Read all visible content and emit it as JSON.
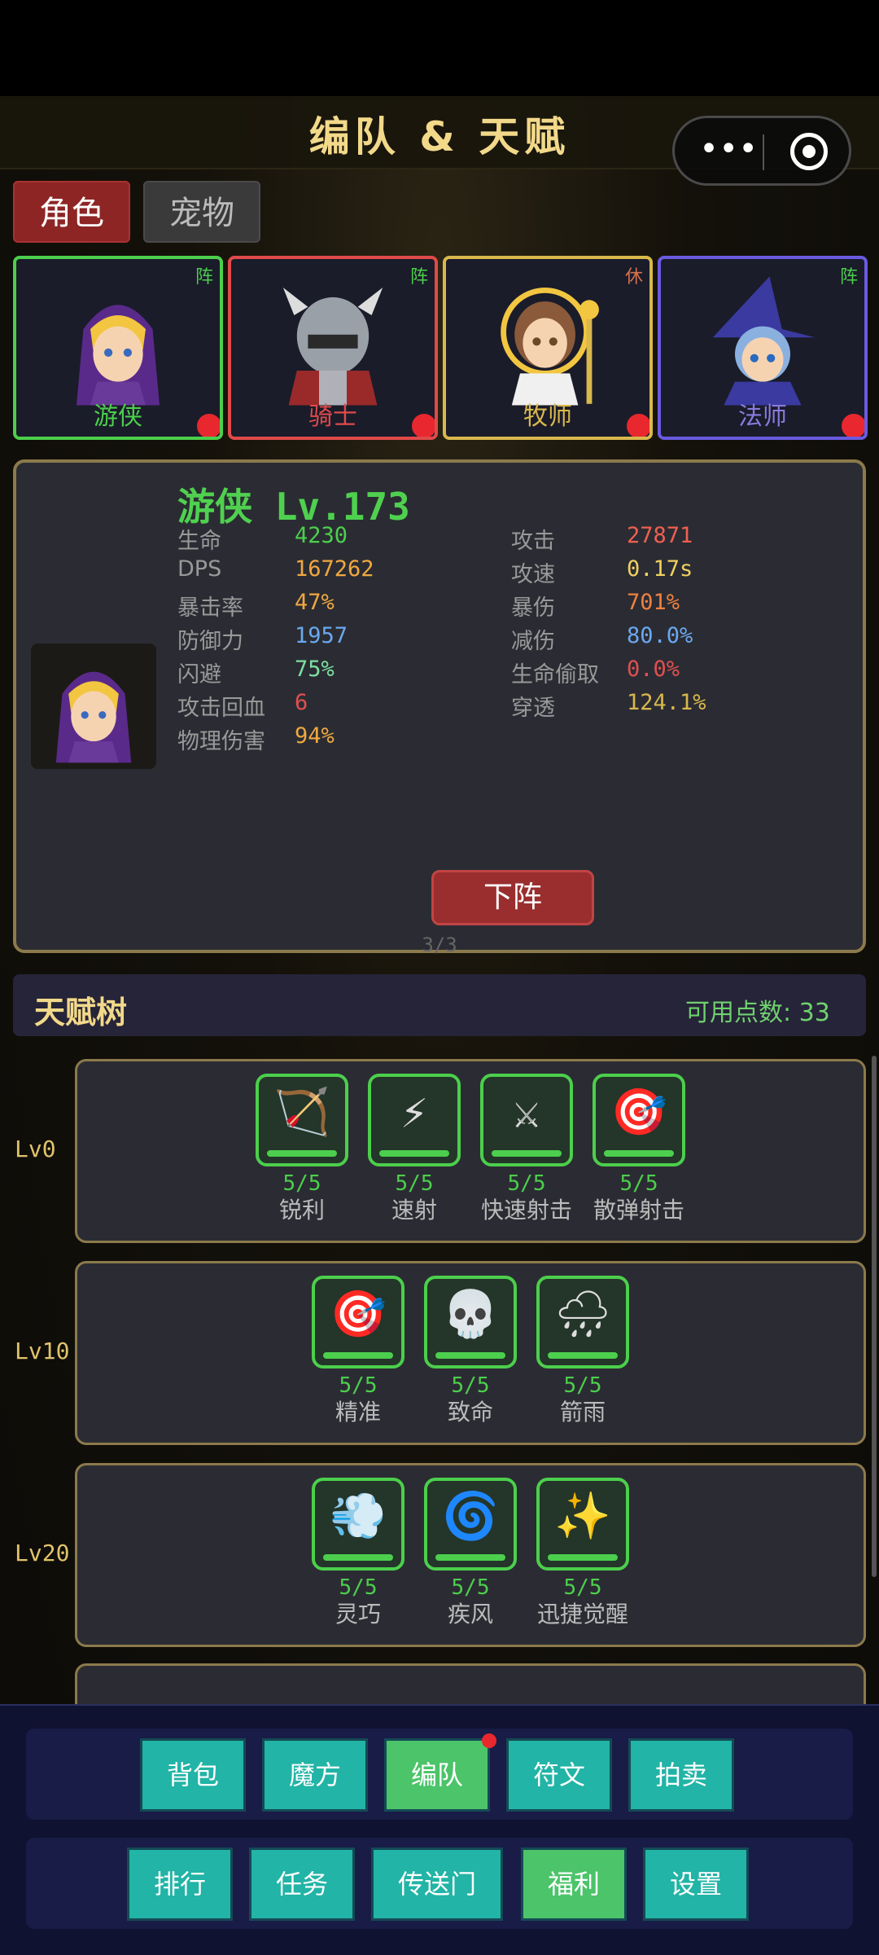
{
  "header": {
    "title": "编队 & 天赋"
  },
  "tabs": [
    {
      "label": "角色"
    },
    {
      "label": "宠物"
    }
  ],
  "heroes": [
    {
      "name": "游侠",
      "tag": "阵",
      "color": "#4ccf4c"
    },
    {
      "name": "骑士",
      "tag": "阵",
      "color": "#e04a4a"
    },
    {
      "name": "牧师",
      "tag": "休",
      "color": "#d9b84c"
    },
    {
      "name": "法师",
      "tag": "阵",
      "color": "#6a5ae0"
    }
  ],
  "selected": {
    "title": "游侠 Lv.173",
    "left_stats": [
      {
        "label": "生命",
        "value": "4230",
        "color": "#4ccf4c"
      },
      {
        "label": "DPS",
        "value": "167262",
        "color": "#f0a840"
      },
      {
        "label": "暴击率",
        "value": "47%",
        "color": "#f0a840"
      },
      {
        "label": "防御力",
        "value": "1957",
        "color": "#6aa8f0"
      },
      {
        "label": "闪避",
        "value": "75%",
        "color": "#7ee0a0"
      },
      {
        "label": "攻击回血",
        "value": "6",
        "color": "#e05050"
      },
      {
        "label": "物理伤害",
        "value": "94%",
        "color": "#f0a840"
      }
    ],
    "right_stats": [
      {
        "label": "攻击",
        "value": "27871",
        "color": "#f06050"
      },
      {
        "label": "攻速",
        "value": "0.17s",
        "color": "#f0d060"
      },
      {
        "label": "暴伤",
        "value": "701%",
        "color": "#f08040"
      },
      {
        "label": "减伤",
        "value": "80.0%",
        "color": "#6aa8f0"
      },
      {
        "label": "生命偷取",
        "value": "0.0%",
        "color": "#e05050"
      },
      {
        "label": "穿透",
        "value": "124.1%",
        "color": "#d9b84c"
      }
    ],
    "action_label": "下阵",
    "page_indicator": "3/3"
  },
  "talent": {
    "title": "天赋树",
    "points": "可用点数: 33",
    "tiers": [
      {
        "level": "Lv0",
        "skills": [
          {
            "count": "5/5",
            "name": "锐利",
            "icon": "bow-icon",
            "glyph": "🏹"
          },
          {
            "count": "5/5",
            "name": "速射",
            "icon": "lightning-icon",
            "glyph": "⚡"
          },
          {
            "count": "5/5",
            "name": "快速射击",
            "icon": "swords-icon",
            "glyph": "⚔"
          },
          {
            "count": "5/5",
            "name": "散弹射击",
            "icon": "target-icon",
            "glyph": "🎯"
          }
        ]
      },
      {
        "level": "Lv10",
        "skills": [
          {
            "count": "5/5",
            "name": "精准",
            "icon": "target-icon",
            "glyph": "🎯"
          },
          {
            "count": "5/5",
            "name": "致命",
            "icon": "skull-icon",
            "glyph": "💀"
          },
          {
            "count": "5/5",
            "name": "箭雨",
            "icon": "rain-cloud-icon",
            "glyph": "🌧"
          }
        ]
      },
      {
        "level": "Lv20",
        "skills": [
          {
            "count": "5/5",
            "name": "灵巧",
            "icon": "wind-icon",
            "glyph": "💨"
          },
          {
            "count": "5/5",
            "name": "疾风",
            "icon": "cyclone-icon",
            "glyph": "🌀"
          },
          {
            "count": "5/5",
            "name": "迅捷觉醒",
            "icon": "sparkles-icon",
            "glyph": "✨"
          }
        ]
      }
    ]
  },
  "nav": {
    "row1": [
      "背包",
      "魔方",
      "编队",
      "符文",
      "拍卖"
    ],
    "row2": [
      "排行",
      "任务",
      "传送门",
      "福利",
      "设置"
    ]
  }
}
